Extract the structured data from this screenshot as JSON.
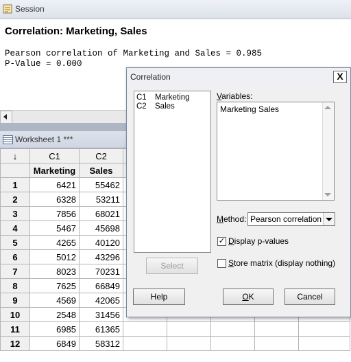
{
  "session": {
    "title": "Session",
    "heading": "Correlation: Marketing, Sales",
    "lines": [
      "Pearson correlation of Marketing and Sales = 0.985",
      "P-Value = 0.000"
    ]
  },
  "worksheet": {
    "title": "Worksheet 1 ***",
    "corner": "↓",
    "columns": [
      "C1",
      "C2"
    ],
    "names": [
      "Marketing",
      "Sales"
    ],
    "rows": [
      {
        "n": "1",
        "m": "6421",
        "s": "55462"
      },
      {
        "n": "2",
        "m": "6328",
        "s": "53211"
      },
      {
        "n": "3",
        "m": "7856",
        "s": "68021"
      },
      {
        "n": "4",
        "m": "5467",
        "s": "45698"
      },
      {
        "n": "5",
        "m": "4265",
        "s": "40120"
      },
      {
        "n": "6",
        "m": "5012",
        "s": "43296"
      },
      {
        "n": "7",
        "m": "8023",
        "s": "70231"
      },
      {
        "n": "8",
        "m": "7625",
        "s": "66849"
      },
      {
        "n": "9",
        "m": "4569",
        "s": "42065"
      },
      {
        "n": "10",
        "m": "2548",
        "s": "31456"
      },
      {
        "n": "11",
        "m": "6985",
        "s": "61365"
      },
      {
        "n": "12",
        "m": "6849",
        "s": "58312"
      }
    ]
  },
  "dialog": {
    "title": "Correlation",
    "close": "X",
    "variable_list": [
      {
        "col": "C1",
        "name": "Marketing"
      },
      {
        "col": "C2",
        "name": "Sales"
      }
    ],
    "variables_label_u": "V",
    "variables_label_rest": "ariables:",
    "variables_value": "Marketing Sales",
    "method_label_u": "M",
    "method_label_rest": "ethod:",
    "method_value": "Pearson correlation",
    "display_pvalues_u": "D",
    "display_pvalues_rest": "isplay p-values",
    "display_pvalues_checked": "✓",
    "store_matrix_u": "S",
    "store_matrix_rest": "tore matrix (display nothing)",
    "select_button": "Select",
    "help_button": "Help",
    "ok_button_u": "O",
    "ok_button_rest": "K",
    "cancel_button": "Cancel"
  }
}
